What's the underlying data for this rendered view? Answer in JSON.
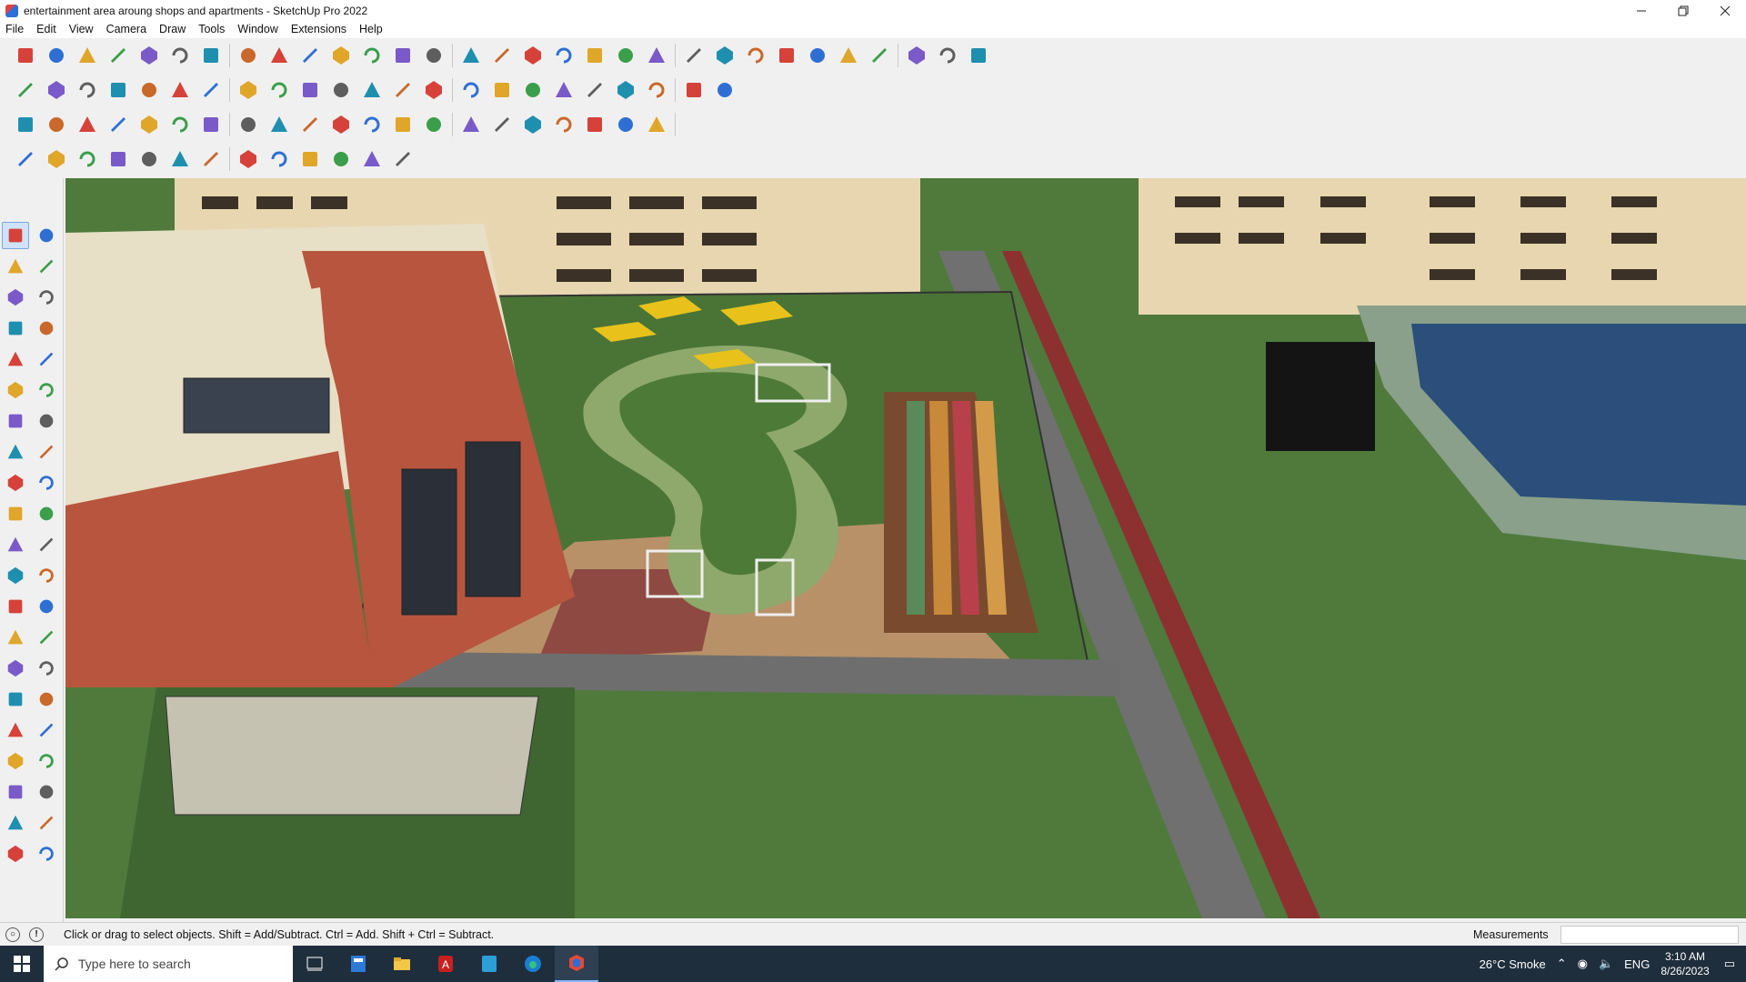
{
  "window": {
    "title": "entertainment area aroung shops and apartments - SketchUp Pro 2022",
    "controls": [
      "minimize",
      "restore",
      "close"
    ]
  },
  "menu": [
    "File",
    "Edit",
    "View",
    "Camera",
    "Draw",
    "Tools",
    "Window",
    "Extensions",
    "Help"
  ],
  "toolbar": {
    "row1": [
      "zoom-icon",
      "select-icon",
      "eraser-icon",
      "pencil-icon",
      "lasso-icon",
      "paint-bucket-icon",
      "push-pull-icon",
      "follow-me-icon",
      "move-icon",
      "rotate-icon",
      "scale-icon",
      "tape-measure-icon",
      "text-icon",
      "paint-icon",
      "orbit-icon",
      "pan-icon",
      "zoom-window-icon",
      "zoom-extents-icon",
      "section-plane-icon",
      "layers-icon",
      "tags-icon",
      "outliner-icon",
      "user-icon",
      "materials-icon",
      "styles-icon",
      "axes-icon",
      "shadow-icon",
      "fog-icon",
      "redo-icon",
      "undo-icon",
      "flag-icon"
    ],
    "row2": [
      "box-icon",
      "sphere-icon",
      "cube-icon",
      "push-icon",
      "arrows-icon",
      "rectangle-icon",
      "polygon-icon",
      "circle-icon",
      "arc-icon",
      "freehand-icon",
      "line-icon",
      "offset-icon",
      "home-icon",
      "building-icon",
      "roof-icon",
      "stairs-icon",
      "door-icon",
      "window-icon",
      "measure-icon",
      "ruler-icon",
      "curve-icon",
      "pen-icon",
      "shape-icon"
    ],
    "row3": [
      "face-icon",
      "plane-icon",
      "layer-icon",
      "plugin-icon",
      "circle-arrow-icon",
      "red-square-icon",
      "grid-icon",
      "frame-icon",
      "wood-icon",
      "cross-icon",
      "plus-icon",
      "star-icon",
      "triangle-icon",
      "sun-icon",
      "loop-icon",
      "tree-icon",
      "magnet-icon",
      "gear-icon",
      "bucket-icon",
      "chain-icon",
      "brick-icon"
    ],
    "row4": [
      "draw-icon",
      "sweep-icon",
      "extrude-icon",
      "curve-tool-icon",
      "twist-icon",
      "bend-icon",
      "fence-icon",
      "railing-icon",
      "stair-icon",
      "texture-icon",
      "hatch-icon",
      "tile-icon",
      "vase-icon"
    ]
  },
  "left_tools": [
    "select-icon",
    "orbit-icon",
    "paint-bucket-icon",
    "eraser-icon",
    "component-icon",
    "pencil-icon",
    "line-icon",
    "freehand-icon",
    "rectangle-icon",
    "rotated-rectangle-icon",
    "circle-icon",
    "polygon-icon",
    "arc-icon",
    "pie-icon",
    "arc2-icon",
    "arc3-icon",
    "move-icon",
    "push-pull-icon",
    "rotate-icon",
    "follow-me-icon",
    "scale-icon",
    "offset-icon",
    "tape-measure-icon",
    "dimension-icon",
    "protractor-icon",
    "text-icon",
    "axes-icon",
    "3d-text-icon",
    "orbit2-icon",
    "pan-icon",
    "zoom-icon",
    "zoom-window-icon",
    "zoom-extents-icon",
    "previous-view-icon",
    "walk-icon",
    "look-around-icon",
    "footprints-icon",
    "section-icon",
    "section-plane-icon",
    "section-fill-icon",
    "layers-icon",
    "styles-icon"
  ],
  "status": {
    "hint": "Click or drag to select objects. Shift = Add/Subtract. Ctrl = Add. Shift + Ctrl = Subtract.",
    "measurements_label": "Measurements",
    "measurements_value": ""
  },
  "taskbar": {
    "search_placeholder": "Type here to search",
    "weather": "26°C  Smoke",
    "lang": "ENG",
    "time": "3:10 AM",
    "date": "8/26/2023"
  },
  "colors": {
    "grass": "#4f7a3c",
    "path": "#8ea96b",
    "brick": "#b8553e",
    "building": "#e8d6b0",
    "pool": "#2b4f7a"
  }
}
